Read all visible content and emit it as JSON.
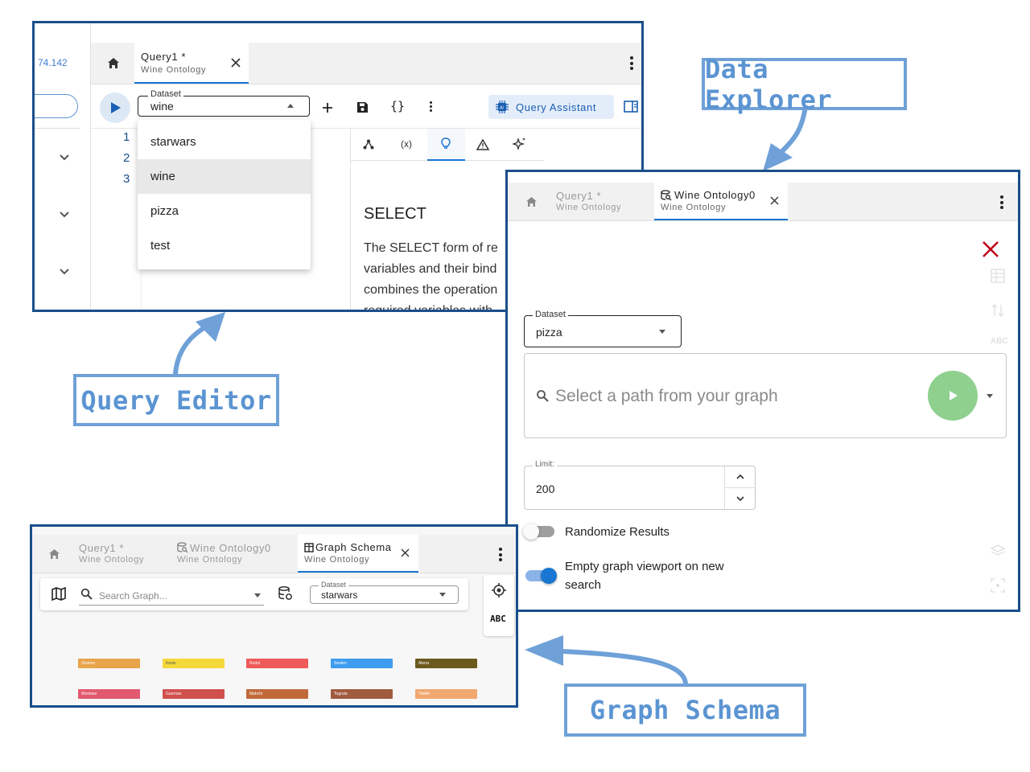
{
  "callouts": {
    "data_explorer": "Data Explorer",
    "query_editor": "Query Editor",
    "graph_schema": "Graph Schema"
  },
  "query_editor": {
    "address_fragment": "74.142",
    "tabs": [
      {
        "title": "Query1 *",
        "subtitle": "Wine Ontology"
      }
    ],
    "dataset": {
      "label": "Dataset",
      "value": "wine"
    },
    "dropdown_options": [
      "starwars",
      "wine",
      "pizza",
      "test"
    ],
    "selected_option": "wine",
    "line_numbers": [
      "1",
      "2",
      "3"
    ],
    "toolbar": {
      "braces": "{}",
      "query_assistant": "Query Assistant"
    },
    "side_tabs": {
      "variables": "(x)"
    },
    "doc": {
      "heading": "SELECT",
      "lines": [
        "The SELECT form of re",
        "variables and their bind",
        "combines the operation",
        "required variables with"
      ]
    }
  },
  "data_explorer": {
    "tabs": [
      {
        "title": "Query1 *",
        "subtitle": "Wine Ontology"
      },
      {
        "title": "Wine Ontology0",
        "subtitle": "Wine Ontology"
      }
    ],
    "dataset": {
      "label": "Dataset",
      "value": "pizza"
    },
    "search_placeholder": "Select a path from your graph",
    "limit": {
      "label": "Limit:",
      "value": "200"
    },
    "randomize_label": "Randomize Results",
    "randomize_on": false,
    "empty_viewport_label_line1": "Empty graph viewport on new",
    "empty_viewport_label_line2": "search",
    "empty_viewport_on": true,
    "rail_abc": "ABC",
    "accent_color": "#1976d2",
    "run_color": "#8fd08f",
    "close_color": "#c0001a"
  },
  "graph_schema": {
    "tabs": [
      {
        "title": "Query1 *",
        "subtitle": "Wine Ontology"
      },
      {
        "title": "Wine Ontology0",
        "subtitle": "Wine Ontology"
      },
      {
        "title": "Graph Schema",
        "subtitle": "Wine Ontology"
      }
    ],
    "search_placeholder": "Search Graph...",
    "dataset": {
      "label": "Dataset",
      "value": "starwars"
    },
    "abc_label": "ABC",
    "nodes_row1": [
      {
        "label": "Shanon",
        "color": "#e8a44a"
      },
      {
        "label": "Kesto",
        "color": "#f5d83a"
      },
      {
        "label": "Rodol",
        "color": "#ef5a5a"
      },
      {
        "label": "Senten",
        "color": "#3f9df0"
      },
      {
        "label": "Akera",
        "color": "#6b5a1e"
      }
    ],
    "nodes_row2": [
      {
        "label": "Wookiee",
        "color": "#e25a70"
      },
      {
        "label": "Guerrian",
        "color": "#d0504e"
      },
      {
        "label": "Mabchi",
        "color": "#c06a3a"
      },
      {
        "label": "Togruta",
        "color": "#a05a3e"
      },
      {
        "label": "Twilek",
        "color": "#f0a870"
      }
    ]
  }
}
